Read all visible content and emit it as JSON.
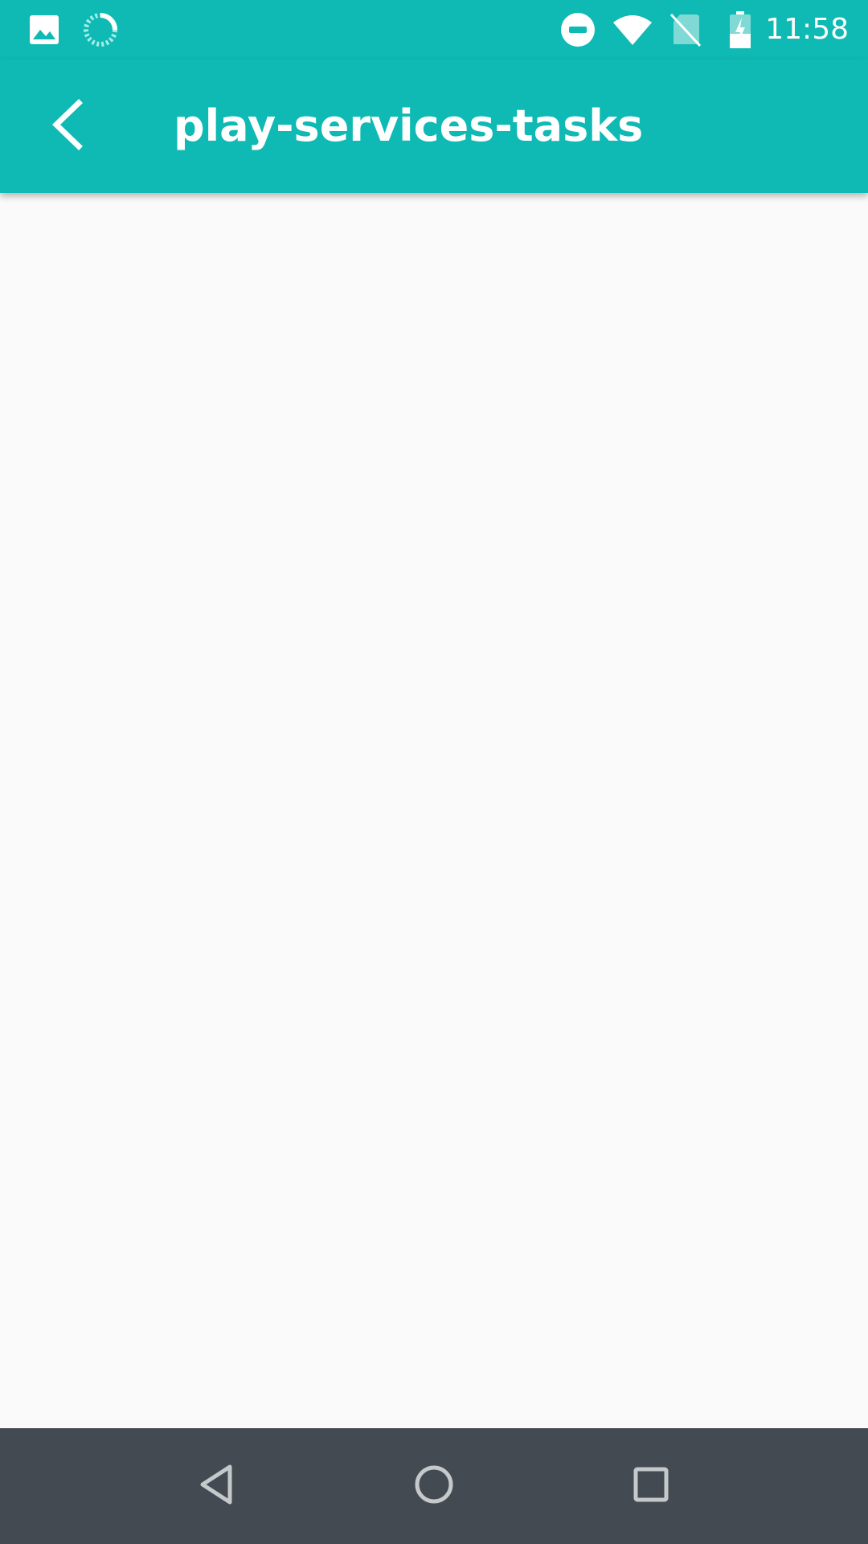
{
  "status_bar": {
    "time": "11:58",
    "icons": [
      "image-icon",
      "sync-spinner-icon",
      "do-not-disturb-icon",
      "wifi-icon",
      "no-sim-icon",
      "battery-charging-icon"
    ]
  },
  "app_bar": {
    "title": "play-services-tasks",
    "back_icon": "back-arrow-icon"
  },
  "nav_bar": {
    "icons": [
      "nav-back-icon",
      "nav-home-icon",
      "nav-recents-icon"
    ]
  },
  "colors": {
    "accent": "#0ebab3",
    "background": "#fafafa",
    "nav_bar": "#434a51"
  }
}
